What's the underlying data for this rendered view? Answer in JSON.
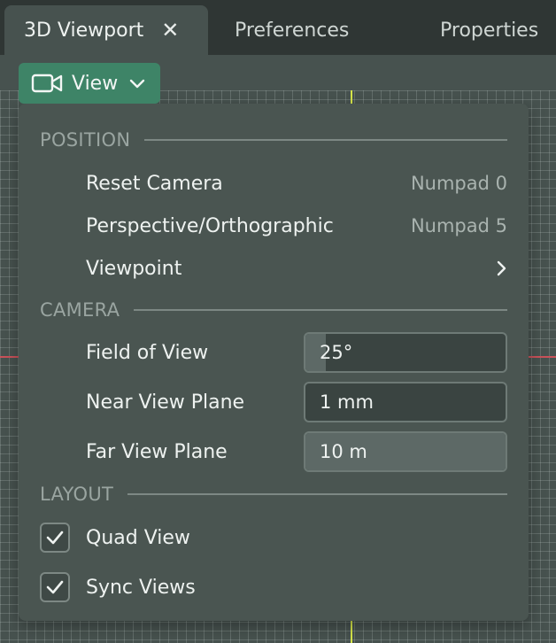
{
  "tabs": [
    {
      "label": "3D Viewport",
      "active": true
    },
    {
      "label": "Preferences"
    },
    {
      "label": "Properties"
    }
  ],
  "close_glyph": "✕",
  "view_button": {
    "label": "View",
    "icon": "camera-icon"
  },
  "menu": {
    "position": {
      "title": "POSITION",
      "items": [
        {
          "label": "Reset Camera",
          "shortcut": "Numpad 0"
        },
        {
          "label": "Perspective/Orthographic",
          "shortcut": "Numpad 5"
        },
        {
          "label": "Viewpoint",
          "submenu": true
        }
      ]
    },
    "camera": {
      "title": "CAMERA",
      "fields": [
        {
          "label": "Field of View",
          "value": "25°",
          "fill_fraction": 0.1
        },
        {
          "label": "Near View Plane",
          "value": "1 mm",
          "fill_fraction": 0.0
        },
        {
          "label": "Far View Plane",
          "value": "10 m",
          "fill_fraction": 1.0
        }
      ]
    },
    "layout": {
      "title": "LAYOUT",
      "checks": [
        {
          "label": "Quad View",
          "checked": true
        },
        {
          "label": "Sync Views",
          "checked": true
        }
      ]
    }
  },
  "colors": {
    "accent": "#3e8467",
    "x_axis": "#c9525a",
    "y_axis": "#d7e64a"
  }
}
